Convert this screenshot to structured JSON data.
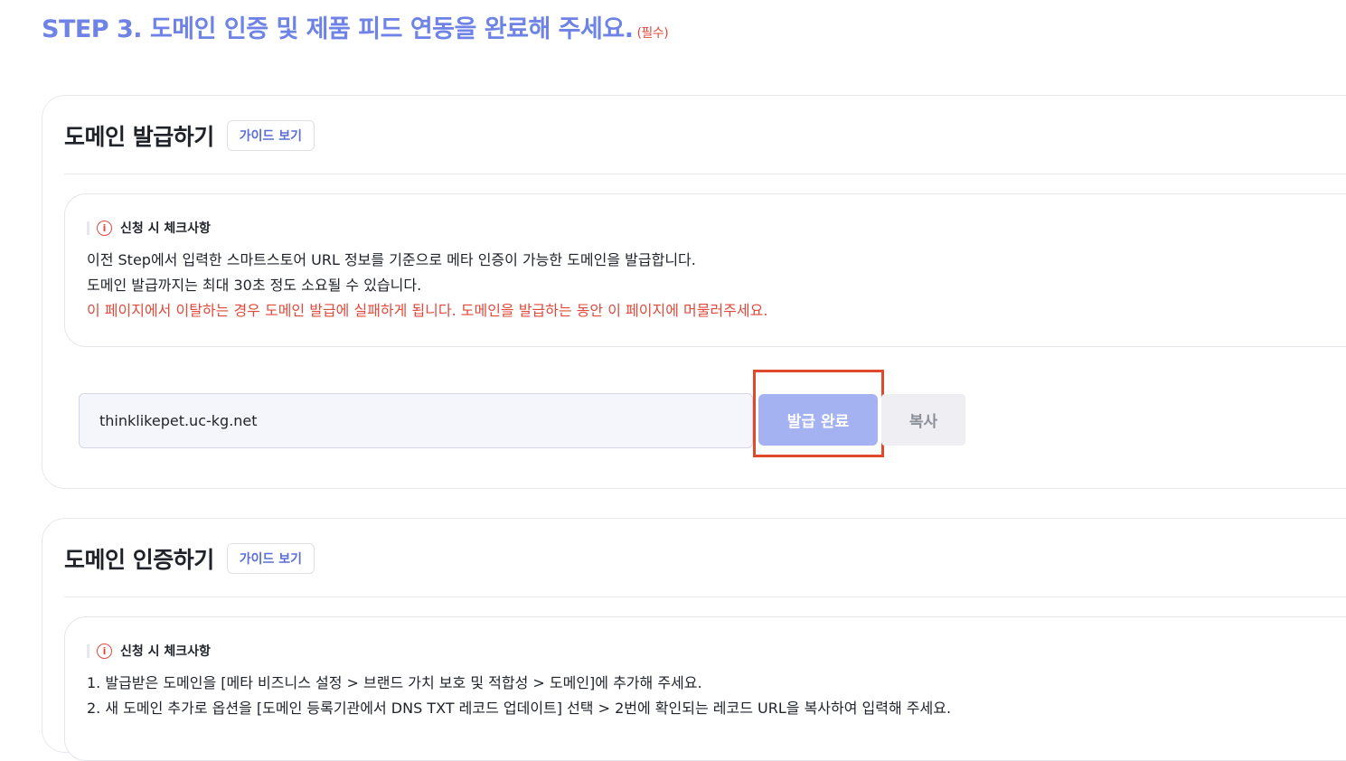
{
  "step": {
    "title": "STEP 3. 도메인 인증 및 제품 피드 연동을 완료해 주세요.",
    "required_label": "(필수)"
  },
  "issue_section": {
    "title": "도메인 발급하기",
    "guide_label": "가이드 보기",
    "notice": {
      "label": "신청 시 체크사항",
      "lines": [
        "이전 Step에서 입력한 스마트스토어 URL 정보를 기준으로 메타 인증이 가능한 도메인을 발급합니다.",
        "도메인 발급까지는 최대 30초 정도 소요될 수 있습니다."
      ],
      "warning": "이 페이지에서 이탈하는 경우 도메인 발급에 실패하게 됩니다. 도메인을 발급하는 동안 이 페이지에 머물러주세요."
    },
    "domain_value": "thinklikepet.uc-kg.net",
    "issue_button_label": "발급 완료",
    "copy_button_label": "복사"
  },
  "verify_section": {
    "title": "도메인 인증하기",
    "guide_label": "가이드 보기",
    "notice": {
      "label": "신청 시 체크사항",
      "lines": [
        "1. 발급받은 도메인을 [메타 비즈니스 설정 > 브랜드 가치 보호 및 적합성 > 도메인]에 추가해 주세요.",
        "2. 새 도메인 추가로 옵션을 [도메인 등록기관에서 DNS TXT 레코드 업데이트] 선택 > 2번에 확인되는 레코드 URL을 복사하여 입력해 주세요."
      ]
    }
  },
  "colors": {
    "accent": "#6f83e6",
    "warning": "#e04a3c",
    "issue_button": "#a5b2f2",
    "highlight": "#e04a2c"
  }
}
